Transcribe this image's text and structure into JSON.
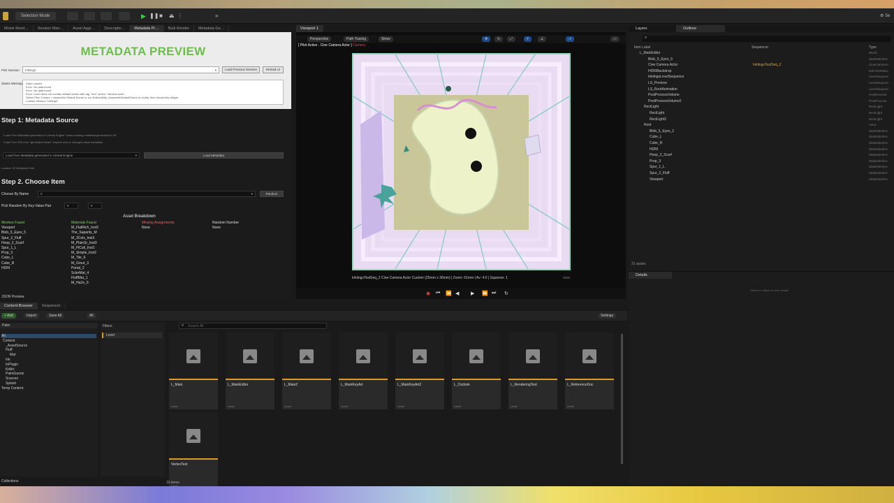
{
  "toolbar": {
    "mode": "Selection Mode",
    "settings": "Se"
  },
  "left_tabs": [
    "Movie Rend…",
    "Session Man…",
    "Asset Aggr…",
    "Descriptio…",
    "Metadata Pr…",
    "Bulk Render",
    "Metadata Ge…"
  ],
  "metadata": {
    "title": "METADATA PREVIEW",
    "pick_label": "Pick Session",
    "pick_value": "Inklings",
    "btn_load_prev": "Load Previous Session",
    "btn_reload": "Reload UI",
    "status_label": "Status Messages",
    "status_lines": [
      "Data Loaded",
      "Error: No data found",
      "Error: No data found",
      "Error: Level does not contain default actors with tag \"root\" and/or \"camera.anim\".",
      "Select Prim Creator > Assemble Default Scene or run EditorUtility_AssembleDefaultScene to rectify, then reload this widget",
      "Loaded Session \"Inklings\""
    ],
    "step1": "Step 1: Metadata Source",
    "step1_note1": "\"Load From Metadata generated in Unreal Engine\" loads existing metadata generated in UE",
    "step1_note2": "\"Load From File from \"generated folder\" imports new or changed asset metadata",
    "source_select": "Load from Metadata generated in Unreal Engine",
    "load_metadata": "Load Metadata",
    "loaded_note": "Loaded: 22 Metadata Sets",
    "step2": "Step 2. Choose Item",
    "choose_label": "Choose By Name",
    "choose_value": "0",
    "random_btn": "Random",
    "kv_label": "Pick Random By Key-Value Pair",
    "breakdown": "Asset Breakdown",
    "meshes_head": "Meshes Found",
    "meshes": [
      "Viewport",
      "Blob_5_Eyes_5",
      "Spur_2_Fluff",
      "Hoop_2_Scarf",
      "Spur_1_L",
      "Prop_3",
      "Cube_L",
      "Cube_R",
      "HDRI"
    ],
    "materials_head": "Materials Found",
    "materials": [
      "M_FlatRich_Inst3",
      "The_Saparity_M",
      "M_3Cols_Inst3",
      "M_PlainSr_Inst3",
      "M_FlCult_Inst1",
      "M_Simple_Inst2",
      "M_Tile_6",
      "M_Grout_3",
      "Portal_2",
      "SclerMat_4",
      "FluffMat_1",
      "M_HaZe_6"
    ],
    "missing_head": "Missing Assignments",
    "missing_value": "None",
    "random_head": "Random Number",
    "random_value": "None"
  },
  "json_preview_label": "JSON Preview",
  "viewport": {
    "tab": "Viewport 1",
    "perspective": "Perspective",
    "path_tracing": "Path Tracing",
    "show": "Show",
    "pilot_text": "[ Pilot Active - Cine Camera Actor ]",
    "pilot_red": "Camera",
    "caption": "InklingsTestSeq_2  Cine Camera Actor  Custom (25mm x 36mm) | Zoom: 61mm | Av: 4.0 | Squeeze: 1",
    "frame_end": "0000"
  },
  "right": {
    "layers_tab": "Layers",
    "outliner_tab": "Outliner",
    "col_label": "Item Label",
    "col_seq": "Sequencer",
    "col_type": "Type",
    "rows": [
      {
        "name": "L_MainEditor",
        "type": "World"
      },
      {
        "name": "Blob_5_Eyes_5",
        "type": "StaticMeshAc"
      },
      {
        "name": "Cine Camera Actor",
        "type": "CineCameraA",
        "seq": "InklingsTestSeq_2"
      },
      {
        "name": "HDRIBackdrop",
        "type": "Edit HDRIBac"
      },
      {
        "name": "InklingsLevelSequence",
        "type": "LevelSequenc"
      },
      {
        "name": "LS_Preview",
        "type": "LevelSequenc"
      },
      {
        "name": "LS_RootAnimation",
        "type": "LevelSequenc"
      },
      {
        "name": "PostProcessVolume",
        "type": "PostProcess"
      },
      {
        "name": "PostProcessVolume2",
        "type": "PostProcess"
      },
      {
        "name": "RectLight",
        "type": "RectLight"
      },
      {
        "name": "RectLight",
        "type": "RectLight"
      },
      {
        "name": "RectLight2",
        "type": "RectLight"
      },
      {
        "name": "Root",
        "type": "Actor"
      },
      {
        "name": "Blob_5_Eyes_2",
        "type": "StaticMeshAc"
      },
      {
        "name": "Cube_L",
        "type": "StaticMeshAc"
      },
      {
        "name": "Cube_R",
        "type": "StaticMeshAc"
      },
      {
        "name": "HDRI",
        "type": "StaticMeshAc"
      },
      {
        "name": "Hoop_2_Scarf",
        "type": "StaticMeshAc"
      },
      {
        "name": "Prop_3",
        "type": "StaticMeshAc"
      },
      {
        "name": "Spur_1_L",
        "type": "StaticMeshAc"
      },
      {
        "name": "Spur_2_Fluff",
        "type": "StaticMeshAc"
      },
      {
        "name": "Viewport",
        "type": "StaticMeshAc"
      }
    ],
    "actor_count": "21 actors",
    "details_tab": "Details",
    "details_hint": "Select an object to view details"
  },
  "content": {
    "tab_browser": "Content Browser",
    "tab_seq": "Sequencer",
    "add": "Add",
    "import": "Import",
    "save_all": "Save All",
    "crumb": "All",
    "settings": "Settings",
    "paths_label": "Palm",
    "tree": [
      "All",
      "Content",
      "_AssetSource",
      "Fluff",
      "Mat",
      "Ink",
      "InPlugin",
      "KitArt",
      "PalmGaretz",
      "Scarves",
      "Splash",
      "Temp Content"
    ],
    "filters_label": "Filters",
    "filter_level": "Level",
    "search_placeholder": "Search All",
    "assets": [
      "L_Main",
      "L_MainEditor",
      "L_Main2",
      "L_MainKeyArt",
      "L_MainKeyArt2",
      "L_Outlook",
      "L_RenderingTest",
      "L_ReferenceDoc",
      "VertexTest"
    ],
    "asset_type": "Level",
    "count": "10 items",
    "collections": "Collections"
  }
}
